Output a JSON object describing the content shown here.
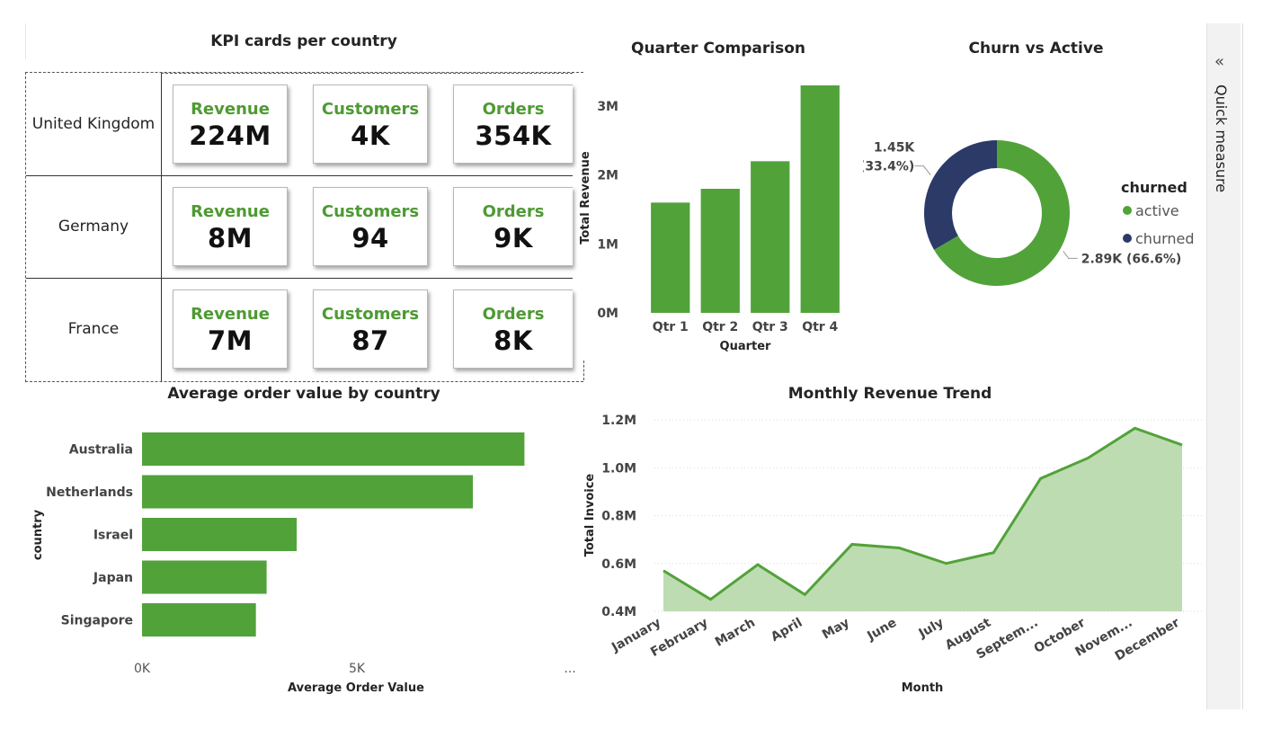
{
  "kpi": {
    "title": "KPI cards per country",
    "rows": [
      {
        "country": "United Kingdom",
        "cards": [
          {
            "label": "Revenue",
            "value": "224M"
          },
          {
            "label": "Customers",
            "value": "4K"
          },
          {
            "label": "Orders",
            "value": "354K"
          }
        ]
      },
      {
        "country": "Germany",
        "cards": [
          {
            "label": "Revenue",
            "value": "8M"
          },
          {
            "label": "Customers",
            "value": "94"
          },
          {
            "label": "Orders",
            "value": "9K"
          }
        ]
      },
      {
        "country": "France",
        "cards": [
          {
            "label": "Revenue",
            "value": "7M"
          },
          {
            "label": "Customers",
            "value": "87"
          },
          {
            "label": "Orders",
            "value": "8K"
          }
        ]
      }
    ]
  },
  "quick_measure": {
    "label": "Quick measure",
    "collapse_icon": "double-chevron-left-icon"
  },
  "colors": {
    "green": "#52a23a",
    "light_green": "#bedcb1",
    "navy": "#2b3a67",
    "label_green": "#4e9a33"
  },
  "chart_data": [
    {
      "type": "bar",
      "title": "Quarter Comparison",
      "xlabel": "Quarter",
      "ylabel": "Total Revenue",
      "categories": [
        "Qtr 1",
        "Qtr 2",
        "Qtr 3",
        "Qtr 4"
      ],
      "values": [
        1600000,
        1800000,
        2200000,
        3300000
      ],
      "ylim": [
        0,
        3300000
      ],
      "yticks": [
        {
          "v": 0,
          "label": "0M"
        },
        {
          "v": 1000000,
          "label": "1M"
        },
        {
          "v": 2000000,
          "label": "2M"
        },
        {
          "v": 3000000,
          "label": "3M"
        }
      ],
      "color": "#52a23a"
    },
    {
      "type": "pie",
      "title": "Churn vs Active",
      "legend_title": "churned",
      "legend_position": "right",
      "slices": [
        {
          "name": "active",
          "value": 2890,
          "label": "2.89K (66.6%)",
          "color": "#52a23a"
        },
        {
          "name": "churned",
          "value": 1450,
          "label_line1": "1.45K",
          "label_line2": "(33.4%)",
          "color": "#2b3a67"
        }
      ]
    },
    {
      "type": "bar",
      "orientation": "horizontal",
      "title": "Average order value by country",
      "xlabel": "Average Order Value",
      "ylabel": "country",
      "categories": [
        "Australia",
        "Netherlands",
        "Israel",
        "Japan",
        "Singapore"
      ],
      "values": [
        8900,
        7700,
        3600,
        2900,
        2650
      ],
      "xlim": [
        0,
        10000
      ],
      "xticks": [
        {
          "v": 0,
          "label": "0K"
        },
        {
          "v": 5000,
          "label": "5K"
        }
      ],
      "xtick_overflow": "...",
      "color": "#52a23a"
    },
    {
      "type": "area",
      "title": "Monthly Revenue Trend",
      "xlabel": "Month",
      "ylabel": "Total Invoice",
      "categories": [
        "January",
        "February",
        "March",
        "April",
        "May",
        "June",
        "July",
        "August",
        "Septem...",
        "October",
        "Novem...",
        "December"
      ],
      "values": [
        570000,
        450000,
        595000,
        470000,
        680000,
        665000,
        600000,
        645000,
        955000,
        1040000,
        1165000,
        1095000
      ],
      "ylim": [
        400000,
        1200000
      ],
      "yticks": [
        {
          "v": 400000,
          "label": "0.4M"
        },
        {
          "v": 600000,
          "label": "0.6M"
        },
        {
          "v": 800000,
          "label": "0.8M"
        },
        {
          "v": 1000000,
          "label": "1.0M"
        },
        {
          "v": 1200000,
          "label": "1.2M"
        }
      ],
      "line_color": "#52a23a",
      "fill_color": "#bedcb1"
    }
  ]
}
